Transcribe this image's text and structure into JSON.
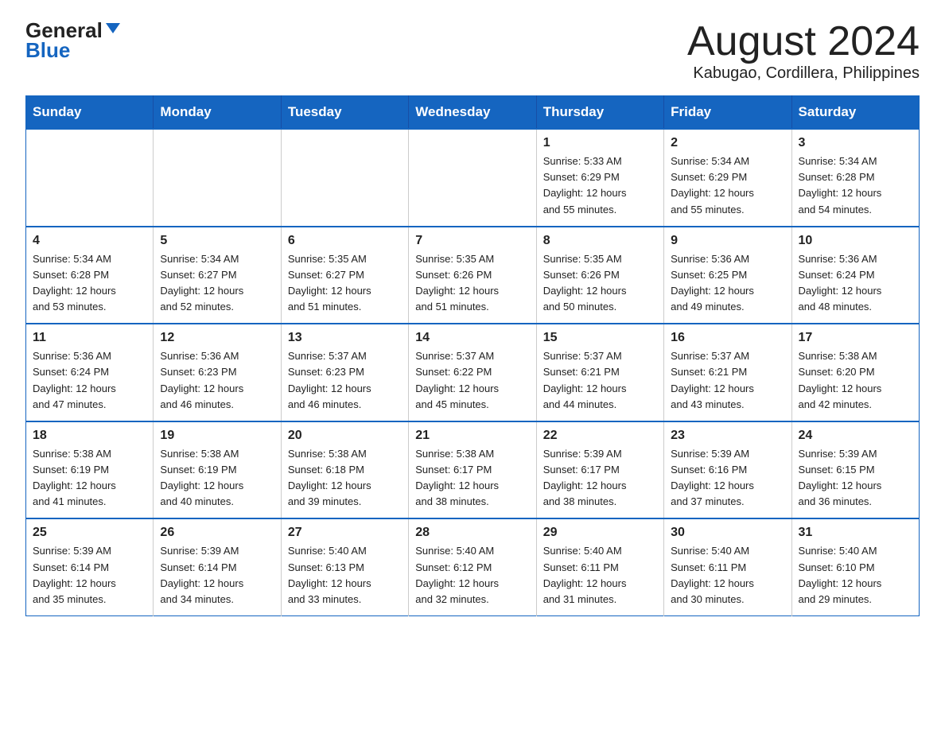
{
  "logo": {
    "text_general": "General",
    "text_blue": "Blue",
    "alt": "GeneralBlue logo"
  },
  "title": "August 2024",
  "subtitle": "Kabugao, Cordillera, Philippines",
  "days_of_week": [
    "Sunday",
    "Monday",
    "Tuesday",
    "Wednesday",
    "Thursday",
    "Friday",
    "Saturday"
  ],
  "weeks": [
    [
      {
        "day": "",
        "info": ""
      },
      {
        "day": "",
        "info": ""
      },
      {
        "day": "",
        "info": ""
      },
      {
        "day": "",
        "info": ""
      },
      {
        "day": "1",
        "info": "Sunrise: 5:33 AM\nSunset: 6:29 PM\nDaylight: 12 hours\nand 55 minutes."
      },
      {
        "day": "2",
        "info": "Sunrise: 5:34 AM\nSunset: 6:29 PM\nDaylight: 12 hours\nand 55 minutes."
      },
      {
        "day": "3",
        "info": "Sunrise: 5:34 AM\nSunset: 6:28 PM\nDaylight: 12 hours\nand 54 minutes."
      }
    ],
    [
      {
        "day": "4",
        "info": "Sunrise: 5:34 AM\nSunset: 6:28 PM\nDaylight: 12 hours\nand 53 minutes."
      },
      {
        "day": "5",
        "info": "Sunrise: 5:34 AM\nSunset: 6:27 PM\nDaylight: 12 hours\nand 52 minutes."
      },
      {
        "day": "6",
        "info": "Sunrise: 5:35 AM\nSunset: 6:27 PM\nDaylight: 12 hours\nand 51 minutes."
      },
      {
        "day": "7",
        "info": "Sunrise: 5:35 AM\nSunset: 6:26 PM\nDaylight: 12 hours\nand 51 minutes."
      },
      {
        "day": "8",
        "info": "Sunrise: 5:35 AM\nSunset: 6:26 PM\nDaylight: 12 hours\nand 50 minutes."
      },
      {
        "day": "9",
        "info": "Sunrise: 5:36 AM\nSunset: 6:25 PM\nDaylight: 12 hours\nand 49 minutes."
      },
      {
        "day": "10",
        "info": "Sunrise: 5:36 AM\nSunset: 6:24 PM\nDaylight: 12 hours\nand 48 minutes."
      }
    ],
    [
      {
        "day": "11",
        "info": "Sunrise: 5:36 AM\nSunset: 6:24 PM\nDaylight: 12 hours\nand 47 minutes."
      },
      {
        "day": "12",
        "info": "Sunrise: 5:36 AM\nSunset: 6:23 PM\nDaylight: 12 hours\nand 46 minutes."
      },
      {
        "day": "13",
        "info": "Sunrise: 5:37 AM\nSunset: 6:23 PM\nDaylight: 12 hours\nand 46 minutes."
      },
      {
        "day": "14",
        "info": "Sunrise: 5:37 AM\nSunset: 6:22 PM\nDaylight: 12 hours\nand 45 minutes."
      },
      {
        "day": "15",
        "info": "Sunrise: 5:37 AM\nSunset: 6:21 PM\nDaylight: 12 hours\nand 44 minutes."
      },
      {
        "day": "16",
        "info": "Sunrise: 5:37 AM\nSunset: 6:21 PM\nDaylight: 12 hours\nand 43 minutes."
      },
      {
        "day": "17",
        "info": "Sunrise: 5:38 AM\nSunset: 6:20 PM\nDaylight: 12 hours\nand 42 minutes."
      }
    ],
    [
      {
        "day": "18",
        "info": "Sunrise: 5:38 AM\nSunset: 6:19 PM\nDaylight: 12 hours\nand 41 minutes."
      },
      {
        "day": "19",
        "info": "Sunrise: 5:38 AM\nSunset: 6:19 PM\nDaylight: 12 hours\nand 40 minutes."
      },
      {
        "day": "20",
        "info": "Sunrise: 5:38 AM\nSunset: 6:18 PM\nDaylight: 12 hours\nand 39 minutes."
      },
      {
        "day": "21",
        "info": "Sunrise: 5:38 AM\nSunset: 6:17 PM\nDaylight: 12 hours\nand 38 minutes."
      },
      {
        "day": "22",
        "info": "Sunrise: 5:39 AM\nSunset: 6:17 PM\nDaylight: 12 hours\nand 38 minutes."
      },
      {
        "day": "23",
        "info": "Sunrise: 5:39 AM\nSunset: 6:16 PM\nDaylight: 12 hours\nand 37 minutes."
      },
      {
        "day": "24",
        "info": "Sunrise: 5:39 AM\nSunset: 6:15 PM\nDaylight: 12 hours\nand 36 minutes."
      }
    ],
    [
      {
        "day": "25",
        "info": "Sunrise: 5:39 AM\nSunset: 6:14 PM\nDaylight: 12 hours\nand 35 minutes."
      },
      {
        "day": "26",
        "info": "Sunrise: 5:39 AM\nSunset: 6:14 PM\nDaylight: 12 hours\nand 34 minutes."
      },
      {
        "day": "27",
        "info": "Sunrise: 5:40 AM\nSunset: 6:13 PM\nDaylight: 12 hours\nand 33 minutes."
      },
      {
        "day": "28",
        "info": "Sunrise: 5:40 AM\nSunset: 6:12 PM\nDaylight: 12 hours\nand 32 minutes."
      },
      {
        "day": "29",
        "info": "Sunrise: 5:40 AM\nSunset: 6:11 PM\nDaylight: 12 hours\nand 31 minutes."
      },
      {
        "day": "30",
        "info": "Sunrise: 5:40 AM\nSunset: 6:11 PM\nDaylight: 12 hours\nand 30 minutes."
      },
      {
        "day": "31",
        "info": "Sunrise: 5:40 AM\nSunset: 6:10 PM\nDaylight: 12 hours\nand 29 minutes."
      }
    ]
  ]
}
